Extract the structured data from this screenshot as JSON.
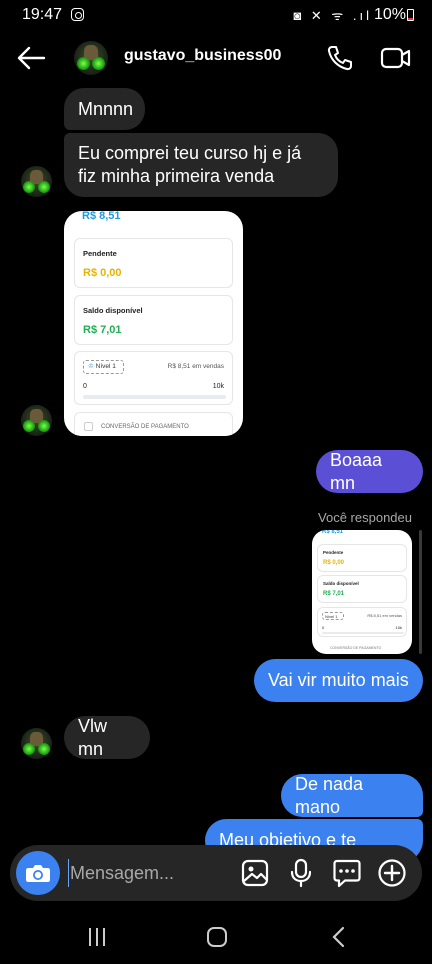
{
  "status_bar": {
    "time": "19:47",
    "system_icons": "◙ ✕ ᯤ .ıl",
    "battery_percent": "10%"
  },
  "header": {
    "username": "gustavo_business00",
    "icons": [
      "back-arrow-icon",
      "avatar",
      "phone-icon",
      "video-icon"
    ]
  },
  "messages": [
    {
      "type": "text",
      "direction": "incoming",
      "text": "Mnnnn"
    },
    {
      "type": "text",
      "direction": "incoming",
      "text": "Eu comprei teu curso hj e já fiz minha primeira venda"
    },
    {
      "type": "image",
      "direction": "incoming",
      "card": {
        "top_amount": "R$ 8,51",
        "pending_label": "Pendente",
        "pending_value": "R$ 0,00",
        "balance_label": "Saldo disponível",
        "balance_value": "R$ 7,01",
        "level_label": "Nível 1",
        "sales_text": "R$ 8,51 em vendas",
        "range_min": "0",
        "range_max": "10k",
        "footer_text": "CONVERSÃO DE PAGAMENTO"
      }
    },
    {
      "type": "text",
      "direction": "outgoing",
      "text": "Boaaa mn",
      "color": "#5b4fd6"
    },
    {
      "type": "reply-label",
      "text": "Você respondeu"
    },
    {
      "type": "image-thumb",
      "direction": "outgoing"
    },
    {
      "type": "text",
      "direction": "outgoing",
      "text": "Vai vir muito mais",
      "color": "#3b82f0"
    },
    {
      "type": "text",
      "direction": "incoming",
      "text": "Vlw mn"
    },
    {
      "type": "text",
      "direction": "outgoing",
      "text": "De nada mano",
      "color": "#3b82f0"
    },
    {
      "type": "text",
      "direction": "outgoing",
      "text": "Meu objetivo e te ajudar",
      "color": "#3b82f0"
    }
  ],
  "composer": {
    "placeholder": "Mensagem...",
    "icons": [
      "camera-icon",
      "gallery-icon",
      "microphone-icon",
      "sticker-icon",
      "plus-icon"
    ]
  },
  "navbar": {
    "icons": [
      "recent-apps-icon",
      "home-icon",
      "back-icon"
    ]
  },
  "colors": {
    "background": "#000000",
    "incoming_bubble": "#262626",
    "outgoing_bubble": "#3b82f0",
    "outgoing_bubble_alt": "#5b4fd6",
    "accent_blue": "#1e9be6",
    "accent_yellow": "#e6b400",
    "accent_green": "#1fae53"
  }
}
